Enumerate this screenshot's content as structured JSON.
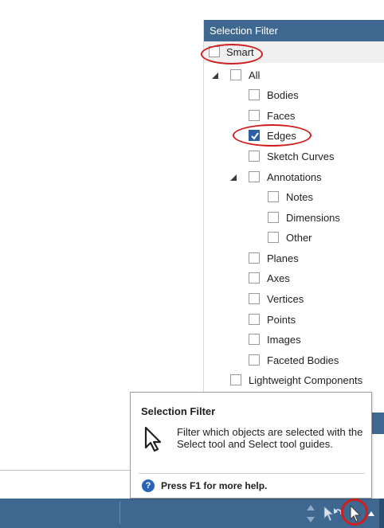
{
  "panel": {
    "title": "Selection Filter",
    "smart": {
      "label": "Smart",
      "checked": false
    },
    "items": [
      {
        "label": "All",
        "checked": false,
        "expander": true
      },
      {
        "label": "Bodies",
        "checked": false
      },
      {
        "label": "Faces",
        "checked": false
      },
      {
        "label": "Edges",
        "checked": true
      },
      {
        "label": "Sketch Curves",
        "checked": false
      },
      {
        "label": "Annotations",
        "checked": false,
        "expander": true
      },
      {
        "label": "Notes",
        "checked": false
      },
      {
        "label": "Dimensions",
        "checked": false
      },
      {
        "label": "Other",
        "checked": false
      },
      {
        "label": "Planes",
        "checked": false
      },
      {
        "label": "Axes",
        "checked": false
      },
      {
        "label": "Vertices",
        "checked": false
      },
      {
        "label": "Points",
        "checked": false
      },
      {
        "label": "Images",
        "checked": false
      },
      {
        "label": "Faceted Bodies",
        "checked": false
      },
      {
        "label": "Lightweight Components",
        "checked": false
      }
    ]
  },
  "tooltip": {
    "title": "Selection Filter",
    "description": "Filter which objects are selected with the Select tool and Select tool guides.",
    "help": "Press F1 for more help.",
    "help_icon": "?"
  },
  "icons": {
    "cursor": "arrow-cursor-icon",
    "help": "help-icon",
    "status": [
      "up-down-arrows-icon",
      "select-tool-icon",
      "undo-select-icon",
      "selection-filter-icon"
    ]
  },
  "colors": {
    "header": "#3f6890",
    "status_bar": "#3f6890",
    "checkbox_checked": "#2c5fa3",
    "highlight_ring": "#d01f1f"
  }
}
